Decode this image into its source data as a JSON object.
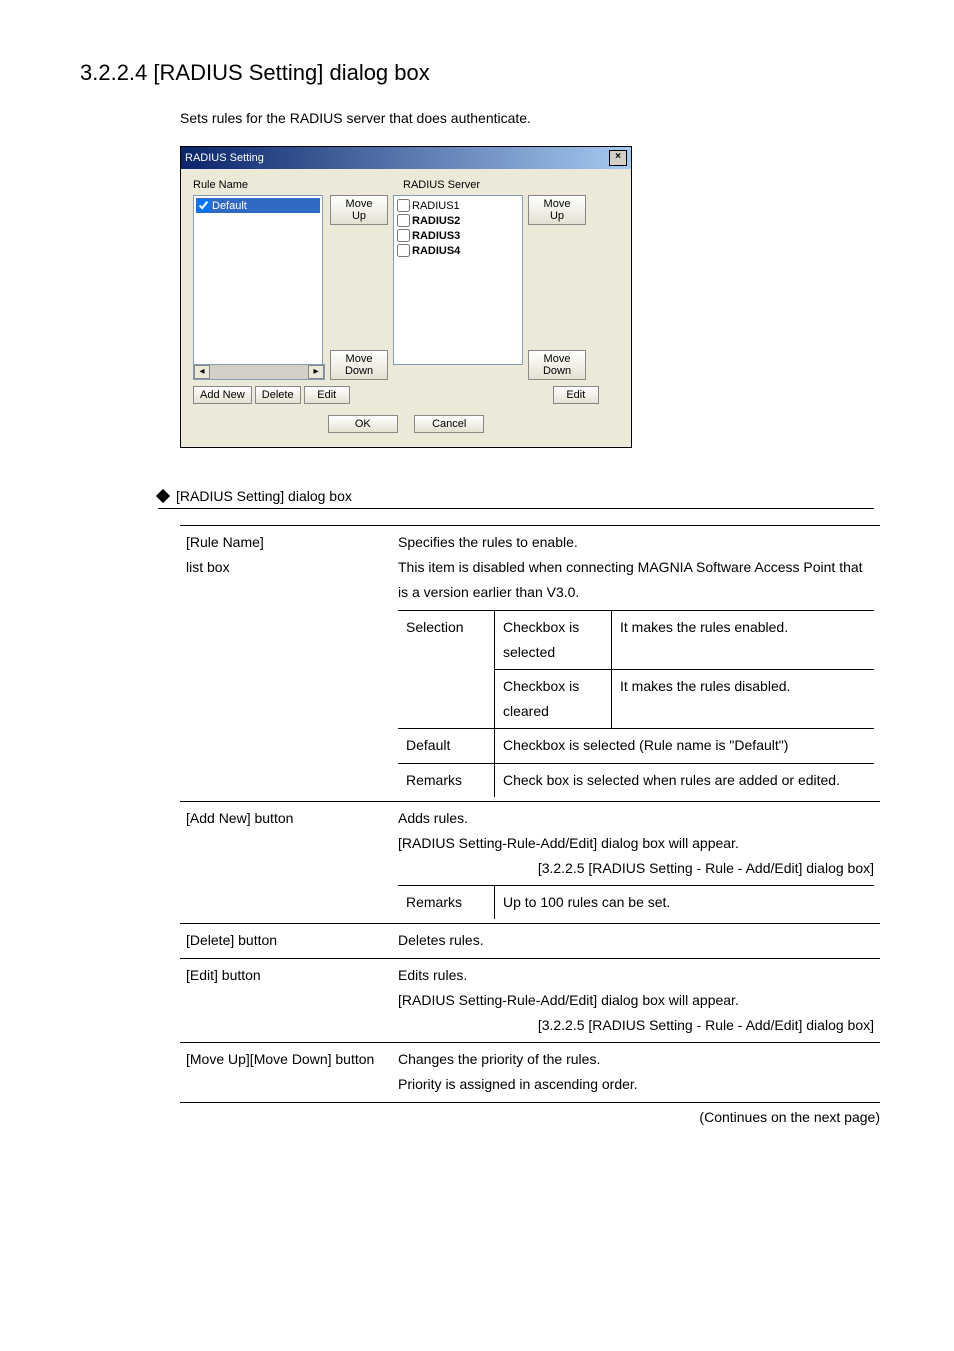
{
  "heading": "3.2.2.4 [RADIUS Setting] dialog box",
  "intro": "Sets rules for the RADIUS server that does authenticate.",
  "dialog": {
    "title": "RADIUS Setting",
    "rule_name_label": "Rule Name",
    "radius_server_label": "RADIUS Server",
    "rule_item_default": "Default",
    "servers": [
      "RADIUS1",
      "RADIUS2",
      "RADIUS3",
      "RADIUS4"
    ],
    "move_up": "Move Up",
    "move_down": "Move Down",
    "add_new": "Add New",
    "delete": "Delete",
    "edit": "Edit",
    "ok": "OK",
    "cancel": "Cancel"
  },
  "subheading": "[RADIUS Setting] dialog box",
  "table": {
    "rule_name": {
      "name": "[Rule Name]\nlist box",
      "desc": "Specifies the rules to enable.\nThis item is disabled when connecting MAGNIA Software Access Point that is a version earlier than V3.0.",
      "selection_label": "Selection",
      "selection_rows": [
        {
          "c": "Checkbox is selected",
          "d": "It makes the rules enabled."
        },
        {
          "c": "Checkbox is cleared",
          "d": "It makes the rules disabled."
        }
      ],
      "default_label": "Default",
      "default_val": "Checkbox is selected (Rule name is \"Default\")",
      "remarks_label": "Remarks",
      "remarks_val": "Check box is selected when rules are added or edited."
    },
    "add_new": {
      "name": "[Add New] button",
      "desc": "Adds rules.\n[RADIUS Setting-Rule-Add/Edit] dialog box will appear.",
      "link": "[3.2.2.5  [RADIUS Setting - Rule - Add/Edit] dialog box]",
      "remarks_label": "Remarks",
      "remarks_val": "Up to 100 rules can be set."
    },
    "delete": {
      "name": "[Delete] button",
      "desc": "Deletes rules."
    },
    "edit": {
      "name": "[Edit] button",
      "desc": "Edits rules.\n[RADIUS Setting-Rule-Add/Edit] dialog box will appear.",
      "link": "[3.2.2.5  [RADIUS Setting - Rule - Add/Edit] dialog box]"
    },
    "move": {
      "name": "[Move Up][Move Down] button",
      "desc": "Changes the priority of the rules.\nPriority is assigned in ascending order."
    }
  },
  "continues": "(Continues on the next page)"
}
